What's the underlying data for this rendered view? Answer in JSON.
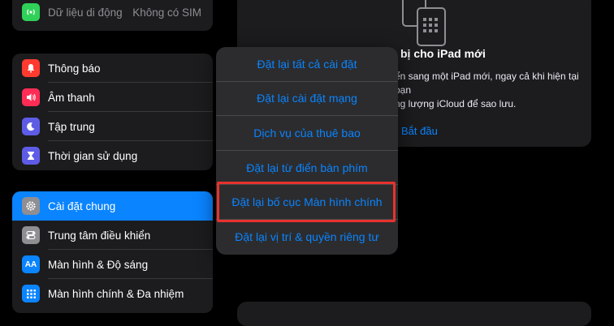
{
  "sidebar": {
    "group1": [
      {
        "label": "Dữ liệu di động",
        "value": "Không có SIM",
        "icon": "cellular-icon",
        "color": "#30d158"
      }
    ],
    "group2": [
      {
        "label": "Thông báo",
        "icon": "bell-icon",
        "color": "#ff3b30"
      },
      {
        "label": "Âm thanh",
        "icon": "speaker-icon",
        "color": "#ff2d55"
      },
      {
        "label": "Tập trung",
        "icon": "moon-icon",
        "color": "#5e5ce6"
      },
      {
        "label": "Thời gian sử dụng",
        "icon": "hourglass-icon",
        "color": "#5e5ce6"
      }
    ],
    "group3": [
      {
        "label": "Cài đặt chung",
        "icon": "gear-icon",
        "color": "#8e8e93",
        "selected": true
      },
      {
        "label": "Trung tâm điều khiển",
        "icon": "toggles-icon",
        "color": "#8e8e93"
      },
      {
        "label": "Màn hình & Độ sáng",
        "icon": "aa-icon",
        "color": "#0a84ff"
      },
      {
        "label": "Màn hình chính & Đa nhiệm",
        "icon": "grid-icon",
        "color": "#0a84ff"
      }
    ]
  },
  "panel": {
    "title": "bị cho iPad mới",
    "desc_line1": "ển sang một iPad mới, ngay cả khi hiện tại bạn",
    "desc_line2": "ng lượng iCloud để sao lưu.",
    "link": "Bắt đầu"
  },
  "menu": {
    "items": [
      "Đặt lại tất cả cài đặt",
      "Đặt lại cài đặt mạng",
      "Dịch vụ của thuê bao",
      "Đặt lại từ điển bàn phím",
      "Đặt lại bố cục Màn hình chính",
      "Đặt lại vị trí & quyền riêng tư"
    ]
  },
  "colors": {
    "accent": "#0a84ff",
    "highlight": "#e8322e"
  }
}
